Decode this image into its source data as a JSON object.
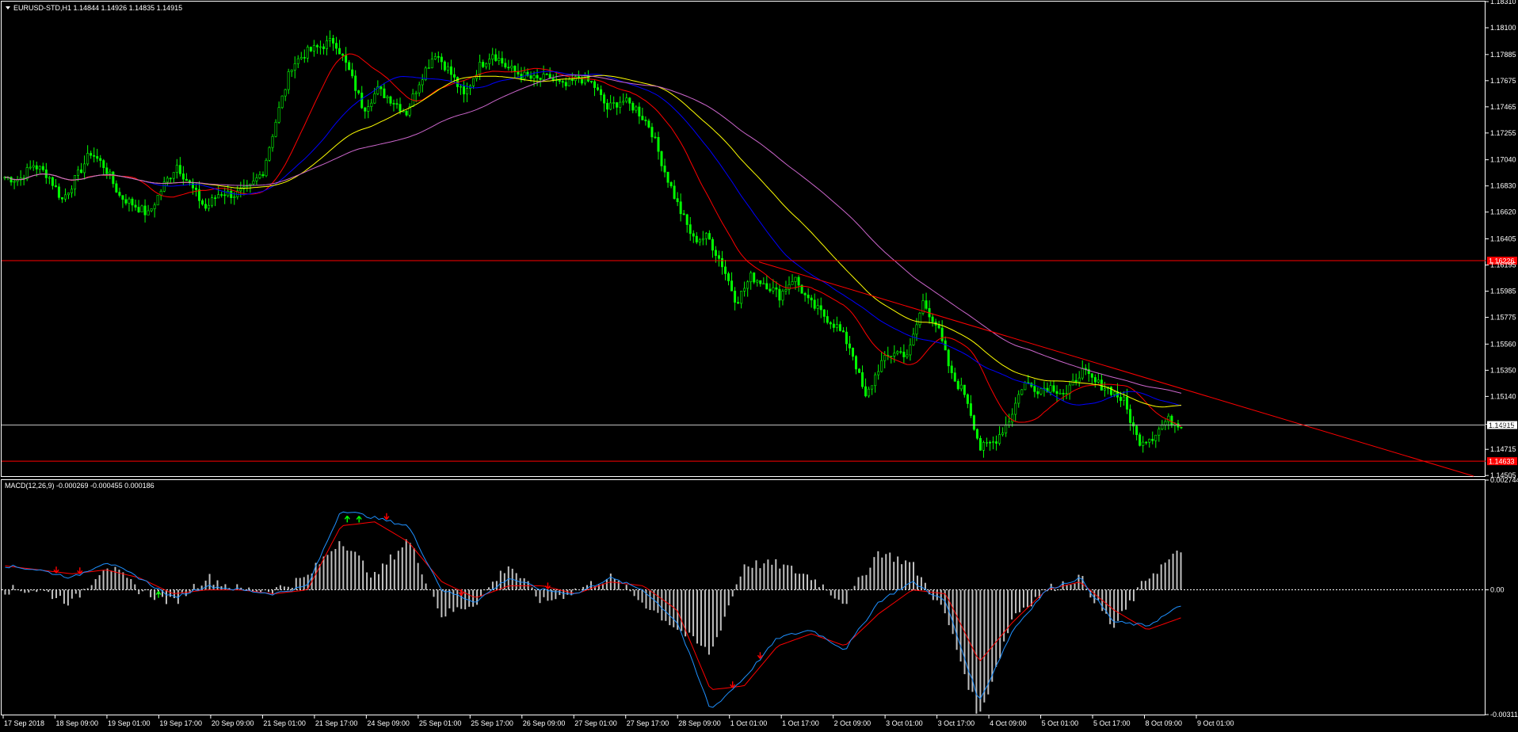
{
  "title": "EURUSD-STD,H1  1.14844 1.14926 1.14835 1.14915",
  "macd_title": "MACD(12,26,9) -0.000269 -0.000455 0.000186",
  "colors": {
    "background": "#000000",
    "candle": "#00ff00",
    "ma_fast": "#ff0000",
    "ma_mid": "#0000ff",
    "ma_slow": "#ffff00",
    "ma_long": "#cc66cc",
    "hline": "#ff0000",
    "trendline": "#ff0000",
    "macd_hist": "#c0c0c0",
    "macd_main": "#1e90ff",
    "macd_signal": "#ff0000",
    "arrow_up": "#00ff00",
    "arrow_down": "#ff0000"
  },
  "chart_data": [
    {
      "type": "candlestick",
      "symbol": "EURUSD-STD",
      "timeframe": "H1",
      "ylim": [
        1.145,
        1.1831
      ],
      "y_ticks": [
        "1.18310",
        "1.18100",
        "1.17885",
        "1.17675",
        "1.17465",
        "1.17255",
        "1.17040",
        "1.16830",
        "1.16620",
        "1.16405",
        "1.16195",
        "1.15985",
        "1.15775",
        "1.15560",
        "1.15350",
        "1.15140",
        "1.14915",
        "1.14715",
        "1.14505"
      ],
      "x_ticks": [
        "17 Sep 2018",
        "18 Sep 09:00",
        "19 Sep 01:00",
        "19 Sep 17:00",
        "20 Sep 09:00",
        "21 Sep 01:00",
        "21 Sep 17:00",
        "24 Sep 09:00",
        "25 Sep 01:00",
        "25 Sep 17:00",
        "26 Sep 09:00",
        "27 Sep 01:00",
        "27 Sep 17:00",
        "28 Sep 09:00",
        "1 Oct 01:00",
        "1 Oct 17:00",
        "2 Oct 09:00",
        "3 Oct 01:00",
        "3 Oct 17:00",
        "4 Oct 09:00",
        "5 Oct 01:00",
        "5 Oct 17:00",
        "8 Oct 09:00",
        "9 Oct 01:00"
      ],
      "price_path": [
        1.169,
        1.1688,
        1.17,
        1.1692,
        1.1672,
        1.169,
        1.171,
        1.1698,
        1.1675,
        1.1668,
        1.166,
        1.1682,
        1.17,
        1.1682,
        1.1665,
        1.1678,
        1.1676,
        1.168,
        1.1695,
        1.174,
        1.178,
        1.179,
        1.1795,
        1.18,
        1.1775,
        1.1745,
        1.176,
        1.1752,
        1.1742,
        1.177,
        1.179,
        1.1775,
        1.1755,
        1.1778,
        1.179,
        1.1778,
        1.1772,
        1.1768,
        1.177,
        1.1762,
        1.177,
        1.1765,
        1.1745,
        1.1752,
        1.1745,
        1.173,
        1.1695,
        1.1665,
        1.164,
        1.1642,
        1.162,
        1.159,
        1.161,
        1.1605,
        1.1595,
        1.161,
        1.159,
        1.158,
        1.157,
        1.1552,
        1.1512,
        1.154,
        1.155,
        1.1548,
        1.159,
        1.157,
        1.153,
        1.1515,
        1.1472,
        1.1478,
        1.1495,
        1.1525,
        1.152,
        1.1522,
        1.1515,
        1.1535,
        1.1525,
        1.152,
        1.151,
        1.1478,
        1.1482,
        1.1495,
        1.1492
      ],
      "horizontal_lines": [
        {
          "price": 1.1623,
          "label": "1.16226"
        },
        {
          "price": 1.1491,
          "label": "1.14915"
        },
        {
          "price": 1.1462,
          "label": "1.14633"
        }
      ],
      "trendline": {
        "from": [
          "1 Oct 17:00",
          1.1622
        ],
        "to": [
          "9 Oct 01:00+",
          1.145
        ]
      }
    },
    {
      "type": "macd",
      "params": "MACD(12,26,9)",
      "ylim": [
        -0.003118,
        0.002744
      ],
      "y_ticks": [
        "0.002744",
        "0.00",
        "-0.003118"
      ],
      "macd_path": [
        0.0006,
        0.0005,
        0.0003,
        0.0007,
        0.0003,
        -0.0002,
        0.0001,
        0.0,
        -0.0001,
        0.0001,
        0.002,
        0.0018,
        0.0016,
        0.0,
        -0.0003,
        0.0003,
        0.0,
        -0.0001,
        0.0003,
        0.0,
        -0.0008,
        -0.003,
        -0.0022,
        -0.0012,
        -0.001,
        -0.0015,
        -0.0003,
        0.0002,
        -0.0003,
        -0.0028,
        -0.001,
        0.0,
        0.0003,
        -0.0008,
        -0.0009,
        -0.0004
      ],
      "signal_path": [
        0.0006,
        0.0005,
        0.0004,
        0.0005,
        0.0003,
        -0.0001,
        0.0,
        0.0,
        -0.0001,
        0.0,
        0.0016,
        0.0017,
        0.0012,
        0.0002,
        -0.0002,
        0.0001,
        0.0001,
        -0.0001,
        0.0002,
        0.0001,
        -0.0005,
        -0.0025,
        -0.0024,
        -0.0014,
        -0.0011,
        -0.0014,
        -0.0006,
        0.0,
        -0.0001,
        -0.0018,
        -0.0008,
        0.0,
        0.0002,
        -0.0005,
        -0.001,
        -0.0007
      ]
    }
  ]
}
